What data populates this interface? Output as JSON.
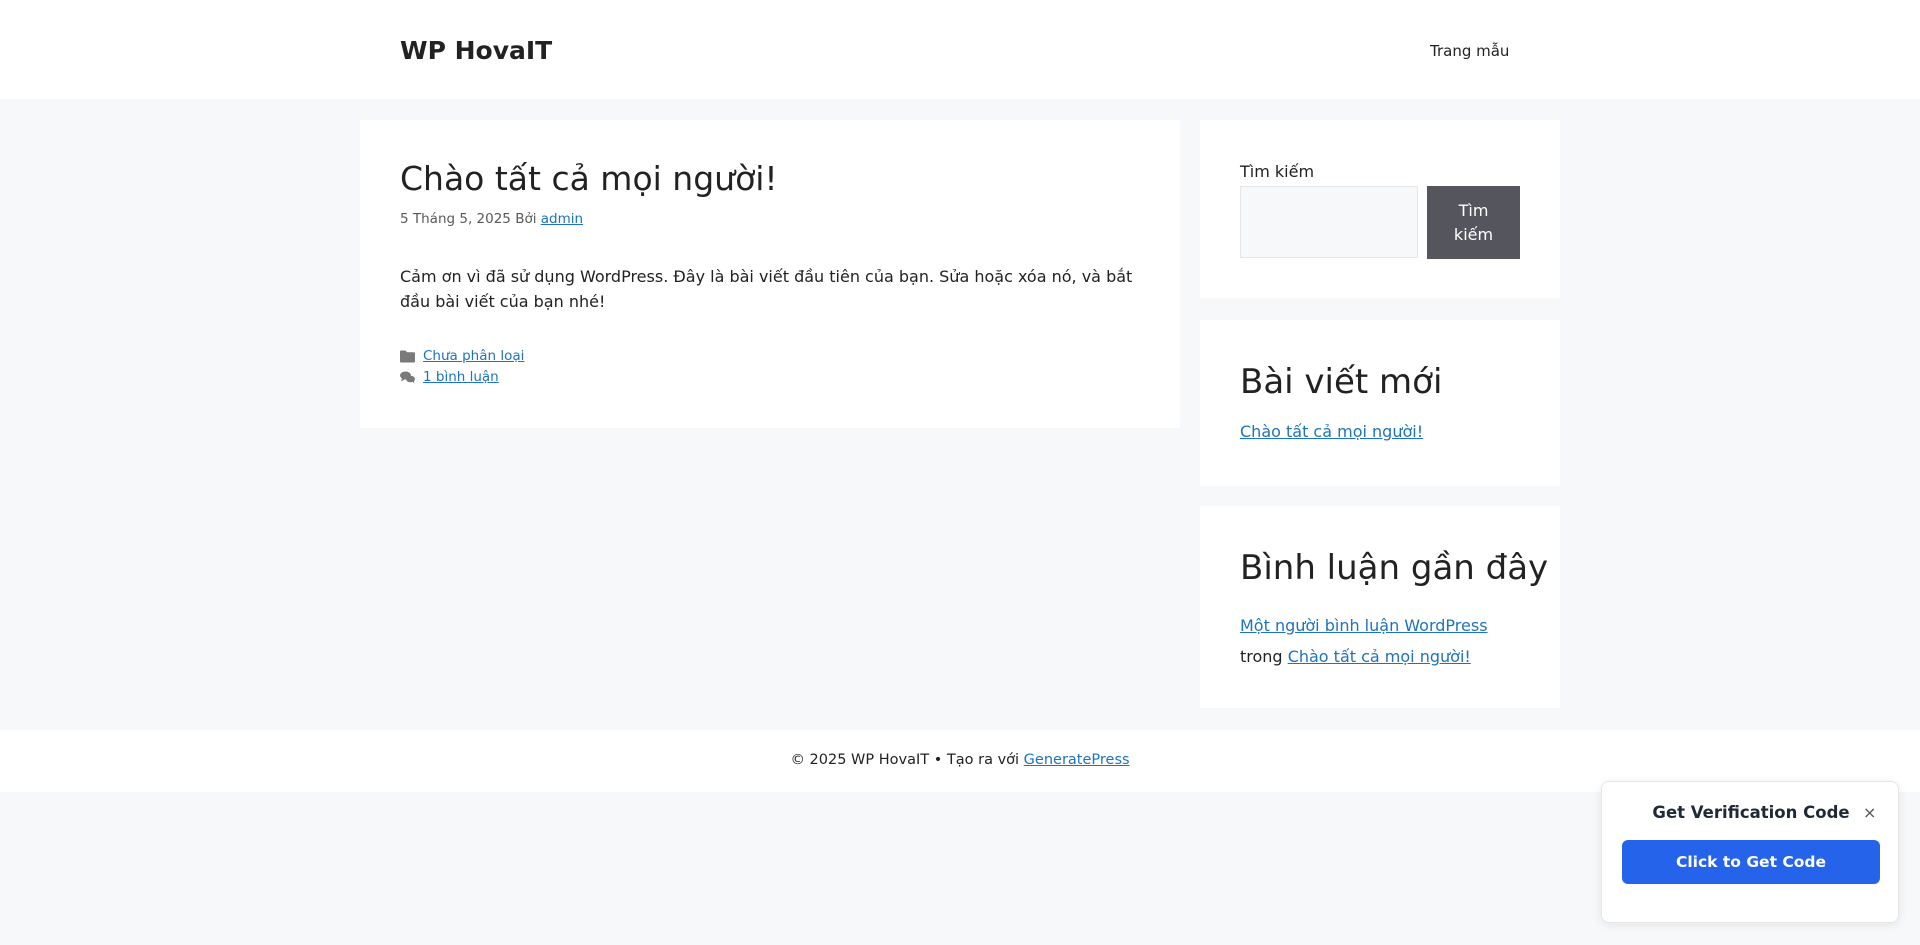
{
  "header": {
    "site_title": "WP HovaIT",
    "nav": [
      {
        "label": "Trang mẫu"
      }
    ]
  },
  "post": {
    "title": "Chào tất cả mọi người!",
    "date": "5 Tháng 5, 2025",
    "by_label": "Bởi",
    "author": "admin",
    "content": "Cảm ơn vì đã sử dụng WordPress. Đây là bài viết đầu tiên của bạn. Sửa hoặc xóa nó, và bắt đầu bài viết của bạn nhé!",
    "category": "Chưa phân loại",
    "comments_link": "1 bình luận",
    "icons": {
      "category": "folder-icon",
      "comments": "comments-icon"
    }
  },
  "sidebar": {
    "search": {
      "label": "Tìm kiếm",
      "button_label": "Tìm kiếm",
      "value": "",
      "placeholder": ""
    },
    "recent_posts": {
      "title": "Bài viết mới",
      "items": [
        {
          "label": "Chào tất cả mọi người!"
        }
      ]
    },
    "recent_comments": {
      "title": "Bình luận gần đây",
      "items": [
        {
          "author": "Một người bình luận WordPress",
          "connector": "trong",
          "post": "Chào tất cả mọi người!"
        }
      ]
    }
  },
  "footer": {
    "copyright_prefix": "© 2025 WP HovaIT • Tạo ra với",
    "theme_link": "GeneratePress"
  },
  "popup": {
    "title": "Get Verification Code",
    "close_symbol": "×",
    "button_label": "Click to Get Code"
  },
  "colors": {
    "page_background": "#f7f8f9",
    "link": "#1e73be",
    "search_button": "#55555e",
    "popup_button": "#2563eb"
  }
}
